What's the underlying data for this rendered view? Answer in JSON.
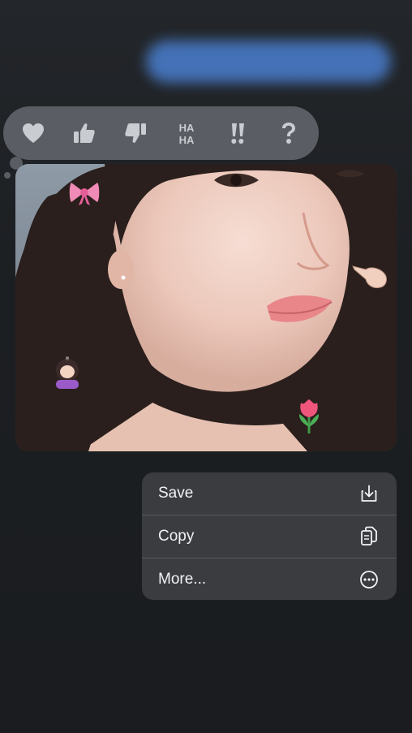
{
  "tapbacks": [
    {
      "name": "heart",
      "label": ""
    },
    {
      "name": "thumbs-up",
      "label": ""
    },
    {
      "name": "thumbs-down",
      "label": ""
    },
    {
      "name": "haha",
      "label": "HA HA"
    },
    {
      "name": "exclamation",
      "label": "!!"
    },
    {
      "name": "question",
      "label": "?"
    }
  ],
  "photo": {
    "stickers": [
      "bow-icon",
      "pointing-hand-icon",
      "girl-emoji-icon",
      "tulip-icon"
    ]
  },
  "menu": {
    "items": [
      {
        "label": "Save",
        "icon": "save-download-icon"
      },
      {
        "label": "Copy",
        "icon": "copy-icon"
      },
      {
        "label": "More...",
        "icon": "more-ellipsis-icon"
      }
    ]
  },
  "colors": {
    "background": "#1b1d20",
    "tapback_bar": "#5a5e64",
    "tapback_icon": "#c9ccd1",
    "menu_bg": "#3a3c40",
    "menu_text": "#f2f2f4",
    "blurred_bubble": "#4a7fd0"
  }
}
